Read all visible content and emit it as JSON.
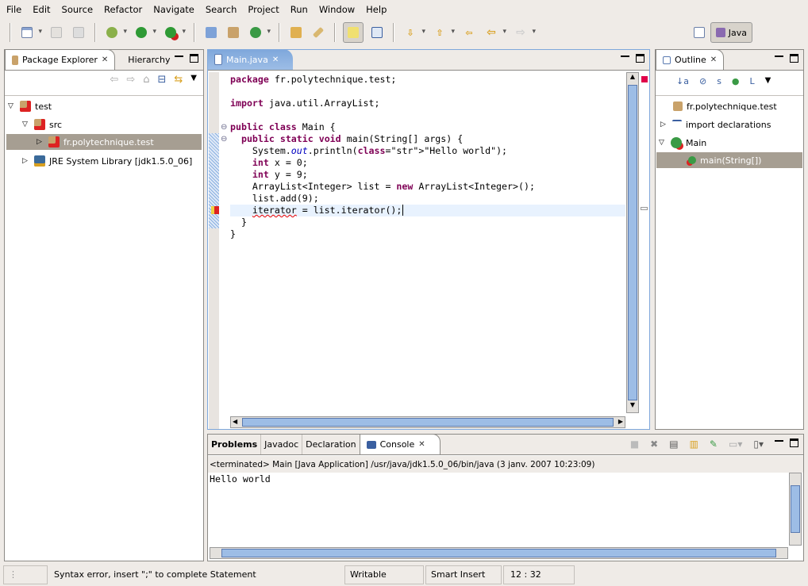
{
  "menu": [
    "File",
    "Edit",
    "Source",
    "Refactor",
    "Navigate",
    "Search",
    "Project",
    "Run",
    "Window",
    "Help"
  ],
  "toolbar": {
    "icons": [
      "new-wizard-icon",
      "save-icon",
      "print-icon",
      "debug-icon",
      "run-icon",
      "run-external-tools-icon",
      "new-java-project-icon",
      "new-package-icon",
      "new-class-icon",
      "open-type-icon",
      "search-icon",
      "mark-occurrences-icon",
      "toggle-block-selection-icon",
      "next-annotation-icon",
      "previous-annotation-icon",
      "last-edit-location-icon",
      "back-icon",
      "forward-icon"
    ],
    "perspective": "Java"
  },
  "package_explorer": {
    "tabs": [
      "Package Explorer",
      "Hierarchy"
    ],
    "tree": [
      {
        "label": "test",
        "level": 0,
        "expanded": true
      },
      {
        "label": "src",
        "level": 1,
        "expanded": true
      },
      {
        "label": "fr.polytechnique.test",
        "level": 2,
        "expanded": false,
        "selected": true
      },
      {
        "label": "JRE System Library [jdk1.5.0_06]",
        "level": 1,
        "expanded": false
      }
    ]
  },
  "editor": {
    "tab": "Main.java",
    "lines": [
      "package fr.polytechnique.test;",
      "",
      "import java.util.ArrayList;",
      "",
      "public class Main {",
      "  public static void main(String[] args) {",
      "    System.out.println(\"Hello world\");",
      "    int x = 0;",
      "    int y = 9;",
      "    ArrayList<Integer> list = new ArrayList<Integer>();",
      "    list.add(9);",
      "    iterator = list.iterator();",
      "  }",
      "}"
    ]
  },
  "outline": {
    "tab": "Outline",
    "items": [
      {
        "label": "fr.polytechnique.test",
        "level": 0
      },
      {
        "label": "import declarations",
        "level": 0,
        "collapsed": true
      },
      {
        "label": "Main",
        "level": 0,
        "expanded": true
      },
      {
        "label": "main(String[])",
        "level": 1,
        "selected": true
      }
    ]
  },
  "console": {
    "tabs": [
      "Problems",
      "Javadoc",
      "Declaration",
      "Console"
    ],
    "header": "<terminated> Main [Java Application] /usr/java/jdk1.5.0_06/bin/java (3 janv. 2007 10:23:09)",
    "output": "Hello world"
  },
  "status": {
    "message": "Syntax error, insert \";\" to complete Statement",
    "mode": "Writable",
    "insert": "Smart Insert",
    "position": "12 : 32"
  },
  "colors": {
    "keyword": "#7f0055",
    "string": "#2a00ff",
    "field": "#0000c0",
    "selection": "#a69e92",
    "active_tab": "#7ea7db"
  }
}
